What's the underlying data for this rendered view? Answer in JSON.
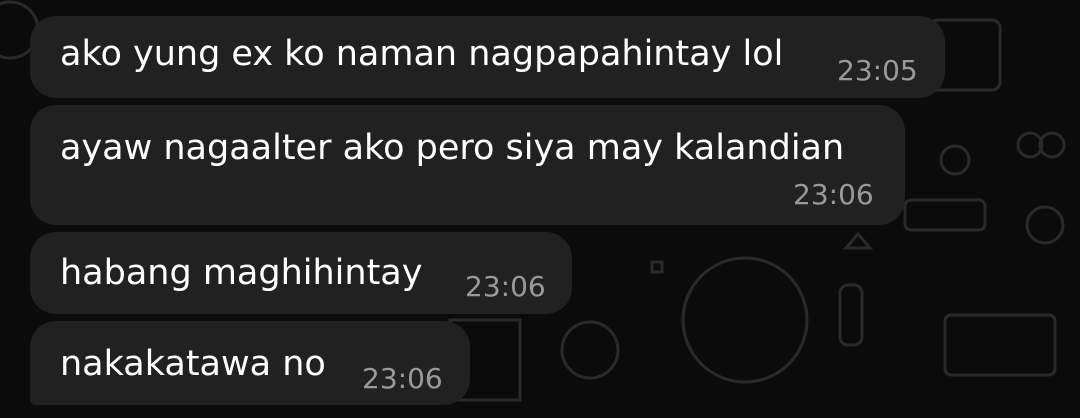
{
  "messages": [
    {
      "text": "ako yung ex ko naman nagpapahintay lol",
      "time": "23:05"
    },
    {
      "text": "ayaw nagaalter ako pero siya may kalandian",
      "time": "23:06"
    },
    {
      "text": "habang maghihintay",
      "time": "23:06"
    },
    {
      "text": "nakakatawa no",
      "time": "23:06"
    }
  ],
  "colors": {
    "background": "#0b0b0b",
    "bubble": "#212121",
    "text": "#ffffff",
    "timestamp": "#9a9a9a"
  }
}
